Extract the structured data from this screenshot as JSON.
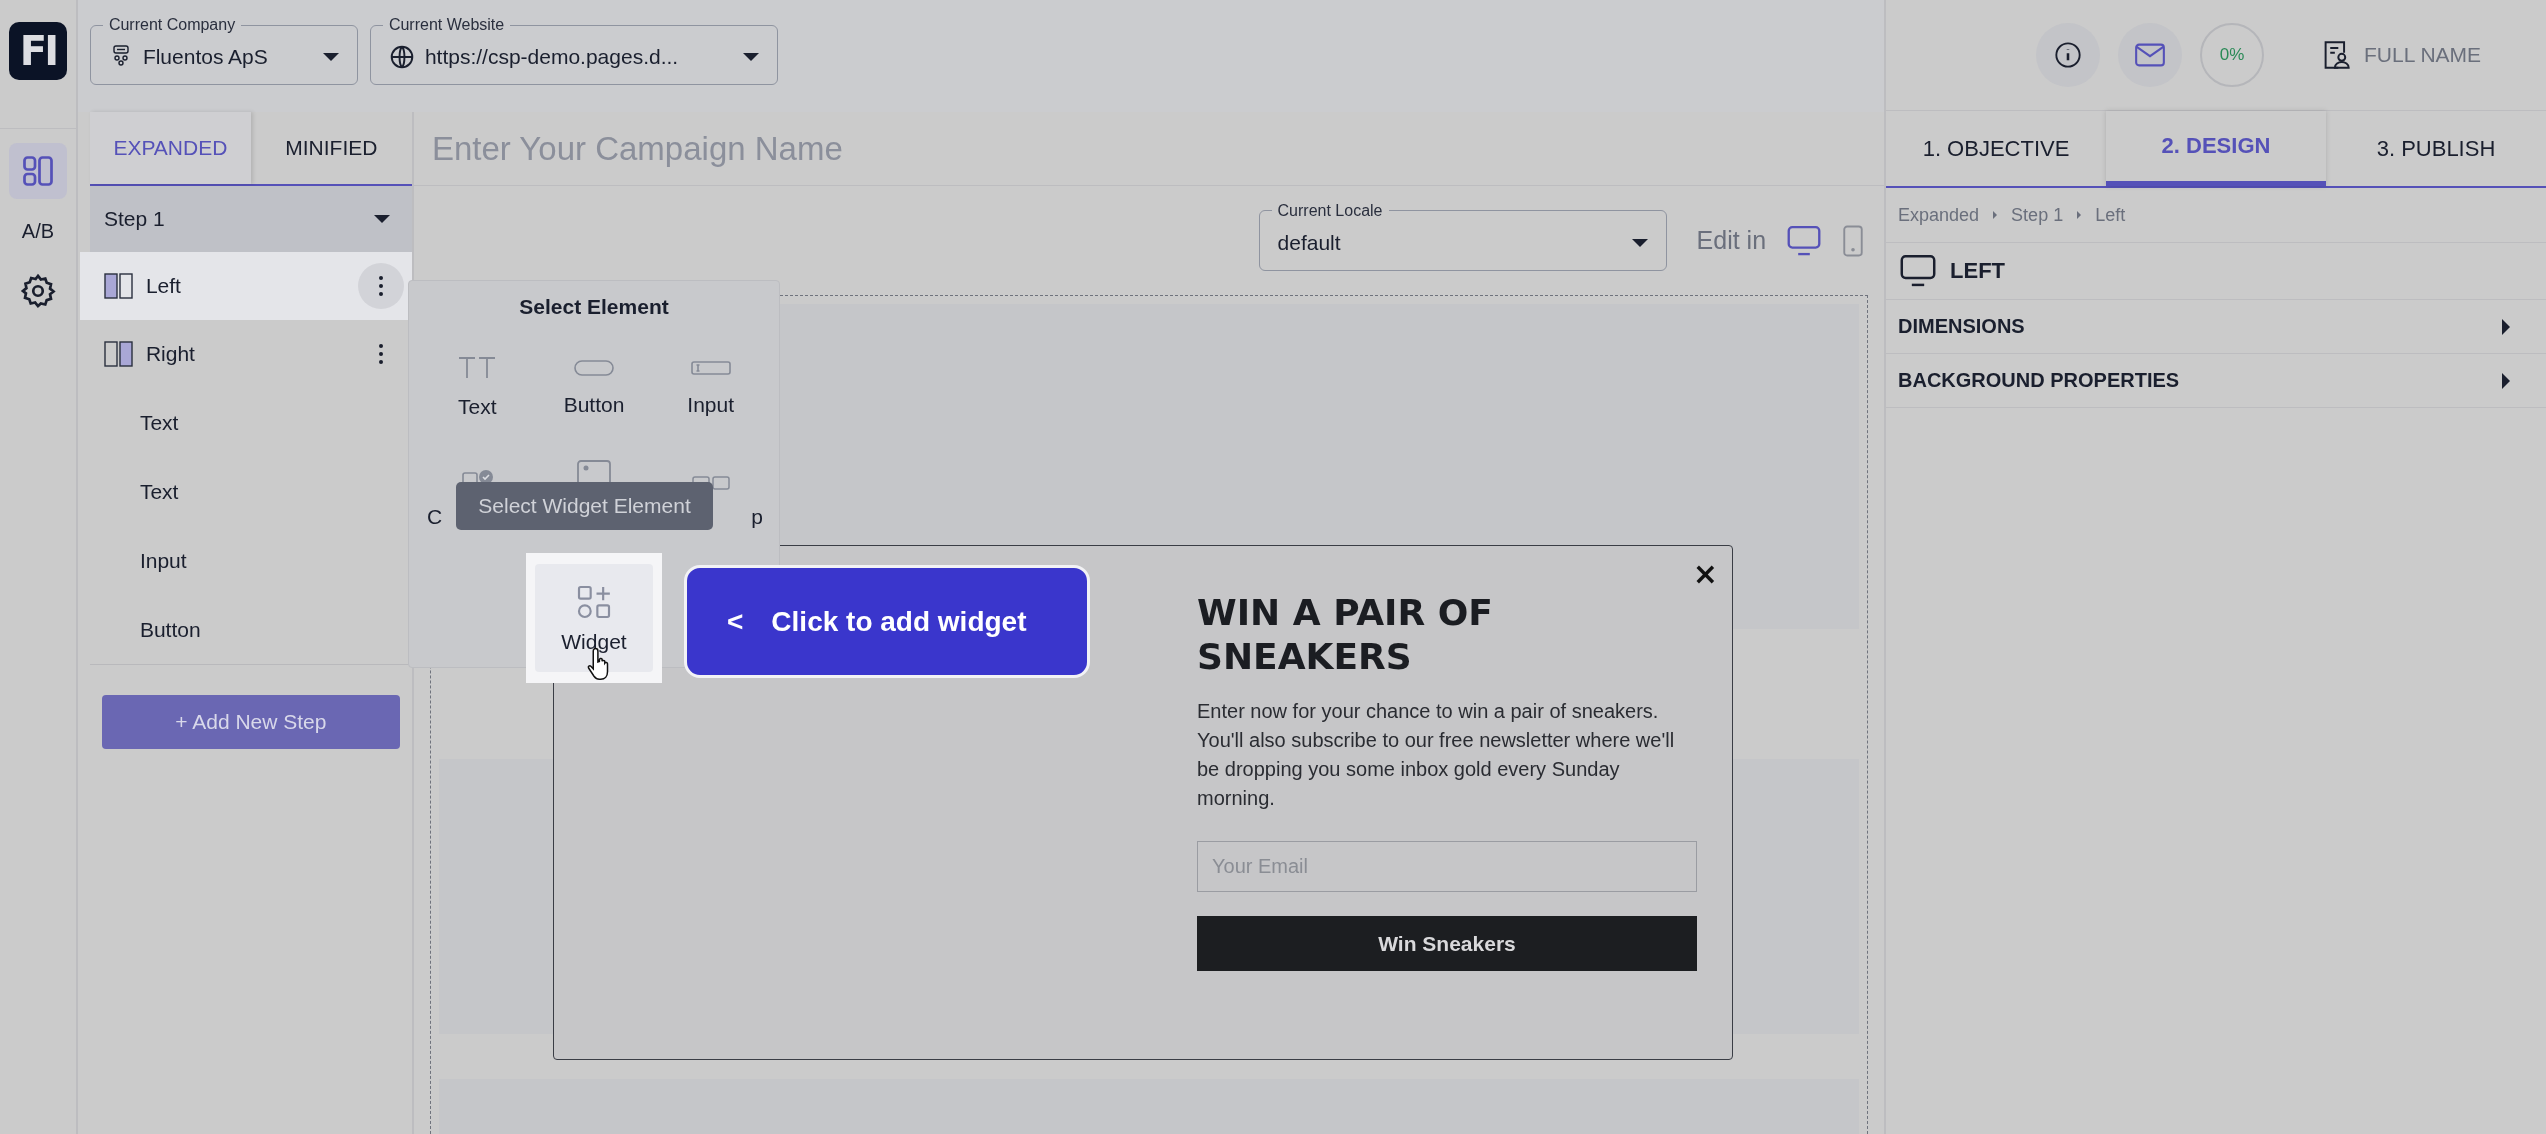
{
  "rail": {
    "logo": "FI",
    "items": [
      {
        "kind": "layout",
        "selected": true
      },
      {
        "kind": "ab",
        "label": "A/B",
        "selected": false
      },
      {
        "kind": "settings",
        "selected": false
      }
    ]
  },
  "header": {
    "company": {
      "label": "Current Company",
      "value": "Fluentos ApS"
    },
    "website": {
      "label": "Current Website",
      "value": "https://csp-demo.pages.d..."
    }
  },
  "view_tabs": [
    {
      "label": "EXPANDED",
      "selected": true
    },
    {
      "label": "MINIFIED",
      "selected": false
    }
  ],
  "step_select": {
    "value": "Step 1"
  },
  "layers": [
    {
      "label": "Left",
      "kind": "left",
      "selected": true
    },
    {
      "label": "Right",
      "kind": "right",
      "selected": false,
      "children": [
        {
          "label": "Text"
        },
        {
          "label": "Text"
        },
        {
          "label": "Input"
        },
        {
          "label": "Button"
        }
      ]
    }
  ],
  "add_step_button": "+ Add New Step",
  "campaign_name": {
    "placeholder": "Enter Your Campaign Name"
  },
  "locale": {
    "label": "Current Locale",
    "value": "default"
  },
  "edit_in": {
    "label": "Edit in",
    "devices": [
      {
        "kind": "desktop",
        "selected": true
      },
      {
        "kind": "mobile",
        "selected": false
      }
    ]
  },
  "element_picker": {
    "title": "Select Element",
    "items": [
      {
        "kind": "text",
        "label": "Text",
        "spotlight": false
      },
      {
        "kind": "button",
        "label": "Button",
        "spotlight": false
      },
      {
        "kind": "input",
        "label": "Input",
        "spotlight": false
      },
      {
        "kind": "checkbox",
        "label": "C",
        "spotlight": false
      },
      {
        "kind": "image",
        "spotlight": false
      },
      {
        "kind": "group",
        "label": "p",
        "spotlight": false
      },
      {
        "kind": "widget",
        "label": "Widget",
        "spotlight": true
      }
    ]
  },
  "tour": {
    "tooltip": "Select Widget Element",
    "callout_arrow": "<",
    "callout": "Click to add widget"
  },
  "popup": {
    "close": "×",
    "title": "WIN A PAIR OF SNEAKERS",
    "body": "Enter now for your chance to win a pair of sneakers. You'll also subscribe to our free newsletter where we'll be dropping you some inbox gold every Sunday morning.",
    "email": {
      "placeholder": "Your Email"
    },
    "submit": "Win Sneakers"
  },
  "top_right": {
    "progress": "0%",
    "user": "FULL NAME"
  },
  "right_tabs": [
    {
      "label": "1. OBJECTIVE",
      "selected": false
    },
    {
      "label": "2. DESIGN",
      "selected": true
    },
    {
      "label": "3. PUBLISH",
      "selected": false
    }
  ],
  "breadcrumb": [
    "Expanded",
    "Step 1",
    "Left"
  ],
  "element_title": "LEFT",
  "sections": [
    {
      "label": "DIMENSIONS",
      "expanded": false
    },
    {
      "label": "BACKGROUND PROPERTIES",
      "expanded": false
    }
  ]
}
